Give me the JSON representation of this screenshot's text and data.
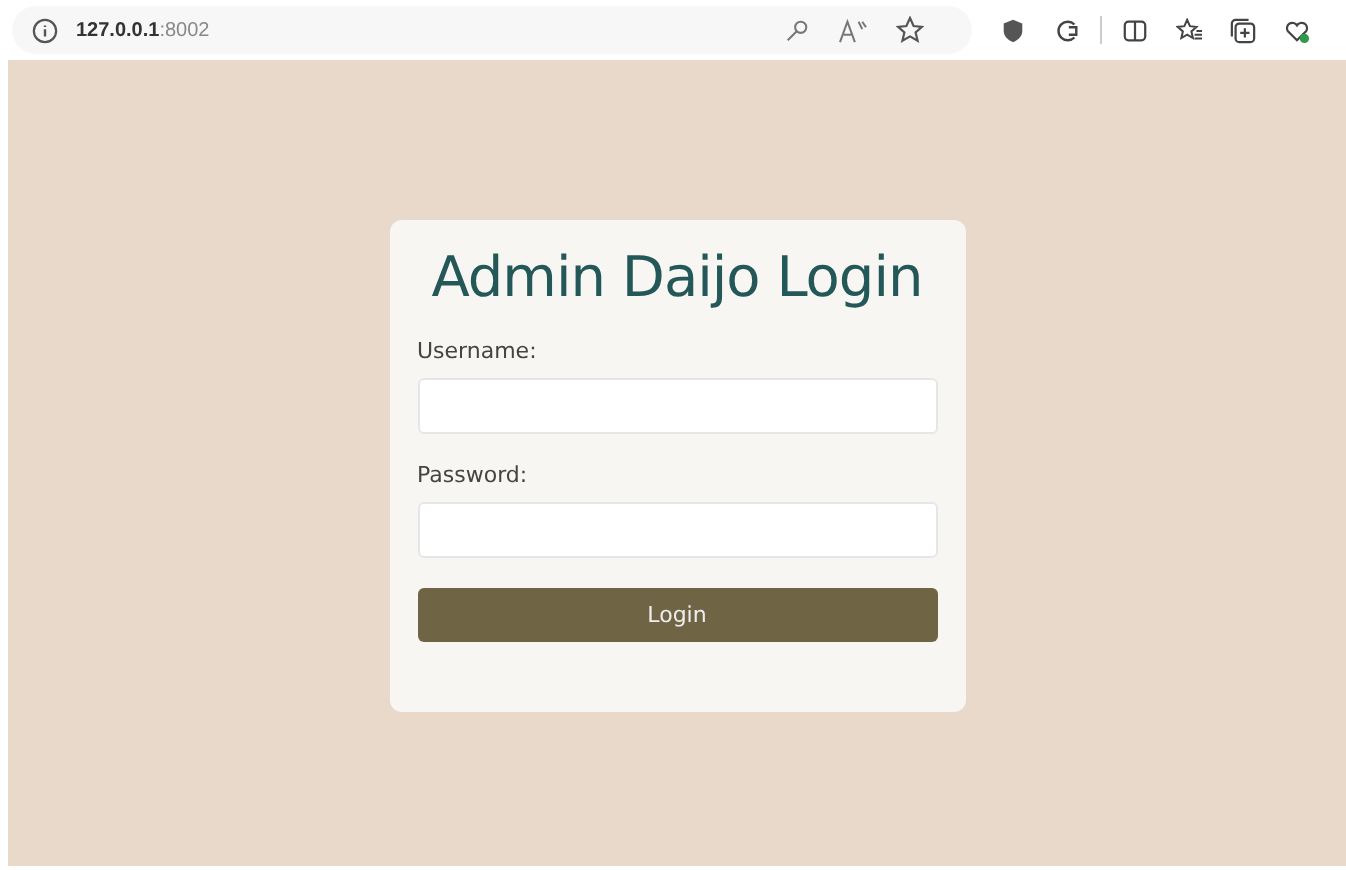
{
  "address_bar": {
    "host": "127.0.0.1",
    "port": ":8002"
  },
  "login_form": {
    "title": "Admin Daijo Login",
    "fields": [
      {
        "label": "Username:"
      },
      {
        "label": "Password:"
      }
    ],
    "button": "Login"
  }
}
